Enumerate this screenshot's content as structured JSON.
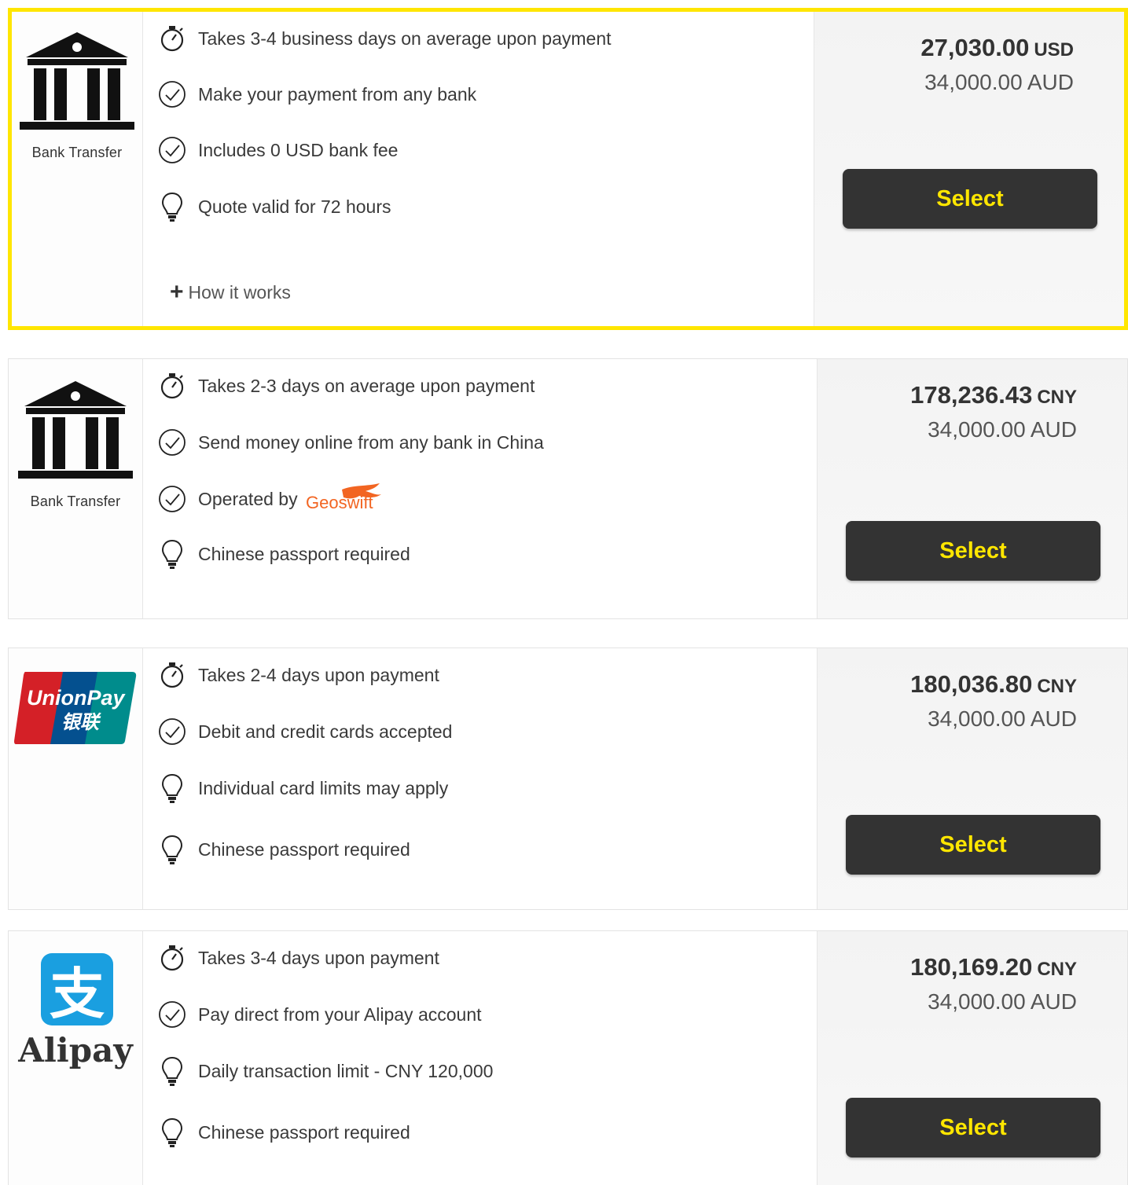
{
  "options": [
    {
      "logo": "bank-transfer",
      "logo_caption": "Bank Transfer",
      "features": [
        {
          "icon": "stopwatch-icon",
          "text": "Takes 3-4 business days on average upon payment"
        },
        {
          "icon": "check-circle-icon",
          "text": "Make your payment from any bank"
        },
        {
          "icon": "check-circle-icon",
          "text": "Includes 0 USD bank fee"
        },
        {
          "icon": "lightbulb-icon",
          "text": "Quote valid for 72 hours"
        }
      ],
      "how_it_works": "How it works",
      "amount": "27,030.00",
      "currency": "USD",
      "source_amount": "34,000.00 AUD",
      "button": "Select"
    },
    {
      "logo": "bank-transfer",
      "logo_caption": "Bank Transfer",
      "features": [
        {
          "icon": "stopwatch-icon",
          "text": "Takes 2-3 days on average upon payment"
        },
        {
          "icon": "check-circle-icon",
          "text": "Send money online from any bank in China"
        },
        {
          "icon": "check-circle-icon",
          "text": "Operated by"
        },
        {
          "icon": "lightbulb-icon",
          "text": "Chinese passport required"
        }
      ],
      "operator_logo_text": "Geoswift",
      "amount": "178,236.43",
      "currency": "CNY",
      "source_amount": "34,000.00 AUD",
      "button": "Select"
    },
    {
      "logo": "unionpay",
      "logo_text": "UnionPay",
      "logo_text_cn": "银联",
      "features": [
        {
          "icon": "stopwatch-icon",
          "text": "Takes 2-4 days upon payment"
        },
        {
          "icon": "check-circle-icon",
          "text": "Debit and credit cards accepted"
        },
        {
          "icon": "lightbulb-icon",
          "text": "Individual card limits may apply"
        },
        {
          "icon": "lightbulb-icon",
          "text": "Chinese passport required"
        }
      ],
      "amount": "180,036.80",
      "currency": "CNY",
      "source_amount": "34,000.00 AUD",
      "button": "Select"
    },
    {
      "logo": "alipay",
      "logo_text": "Alipay",
      "logo_glyph": "支",
      "features": [
        {
          "icon": "stopwatch-icon",
          "text": "Takes 3-4 days upon payment"
        },
        {
          "icon": "check-circle-icon",
          "text": "Pay direct from your Alipay account"
        },
        {
          "icon": "lightbulb-icon",
          "text": "Daily transaction limit - CNY 120,000"
        },
        {
          "icon": "lightbulb-icon",
          "text": "Chinese passport required"
        }
      ],
      "amount": "180,169.20",
      "currency": "CNY",
      "source_amount": "34,000.00 AUD",
      "button": "Select"
    }
  ],
  "colors": {
    "highlight": "#ffe600",
    "button_bg": "#333333",
    "button_text": "#ffe600",
    "unionpay_red": "#d42027",
    "unionpay_blue": "#04508f",
    "unionpay_teal": "#008c8c",
    "alipay_blue": "#1a9fe0",
    "geoswift_orange": "#f26522"
  }
}
